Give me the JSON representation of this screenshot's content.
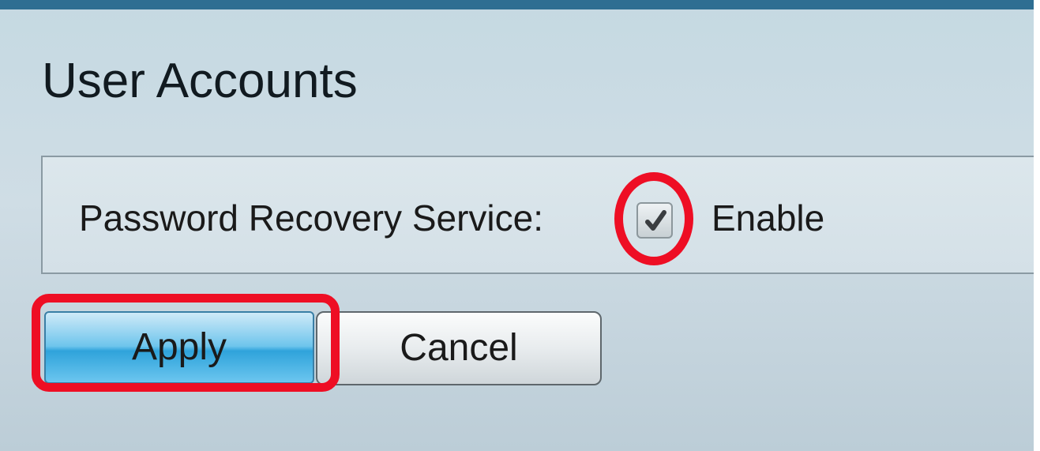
{
  "page": {
    "title": "User Accounts"
  },
  "settings": {
    "password_recovery": {
      "label": "Password Recovery Service:",
      "checkbox_label": "Enable",
      "checked": true
    }
  },
  "actions": {
    "apply_label": "Apply",
    "cancel_label": "Cancel"
  },
  "colors": {
    "top_bar": "#2e6e92",
    "highlight": "#ee0e24",
    "apply_button": "#2fa3db",
    "panel_background": "#c5d9e2"
  },
  "icons": {
    "checkbox_mark": "check-icon"
  }
}
